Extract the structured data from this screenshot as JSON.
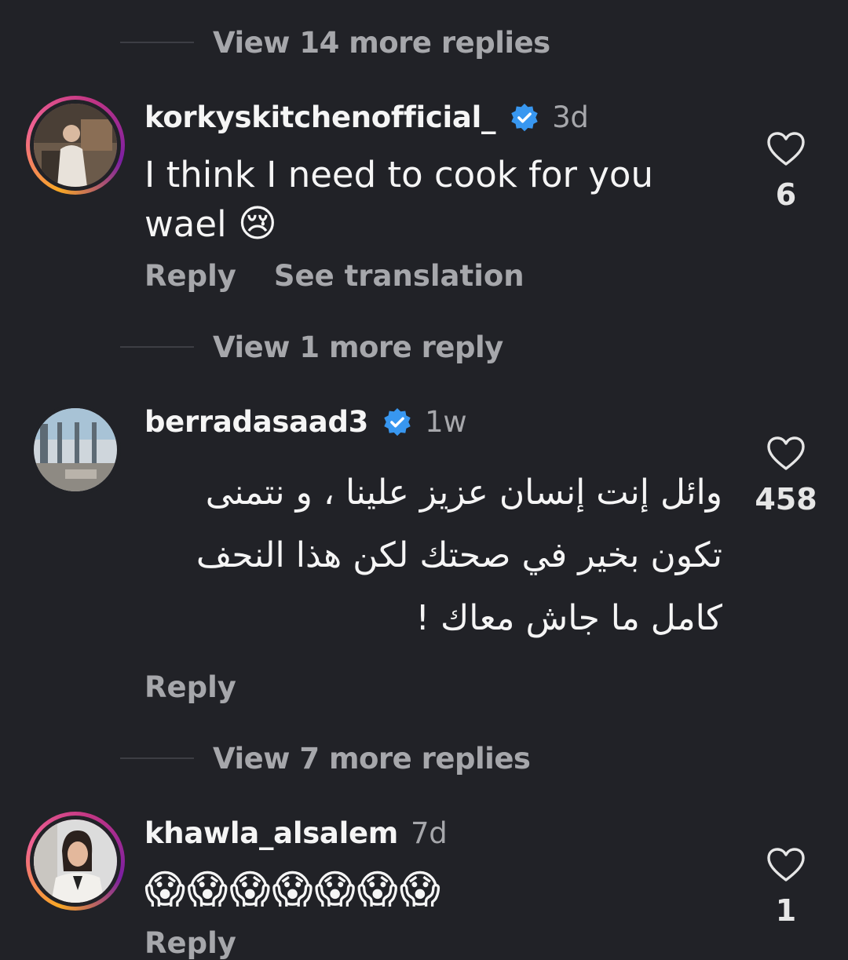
{
  "view_more_1": "View 14 more replies",
  "comments": [
    {
      "username": "korkyskitchenofficial_",
      "verified": true,
      "time": "3d",
      "text_line1": "I think I need to cook for you",
      "text_line2": "wael",
      "emoji": "😢",
      "reply": "Reply",
      "see_translation": "See translation",
      "likes": "6"
    },
    {
      "username": "berradasaad3",
      "verified": true,
      "time": "1w",
      "text_line1": "وائل إنت إنسان عزيز علينا ، و نتمنى",
      "text_line2": "تكون بخير في صحتك لكن هذا النحف",
      "text_line3": "كامل ما جاش معاك !",
      "reply": "Reply",
      "likes": "458"
    },
    {
      "username": "khawla_alsalem",
      "verified": false,
      "time": "7d",
      "emojis": "😱😱😱😱😱😱😱",
      "reply": "Reply",
      "likes": "1"
    }
  ],
  "view_more_2": "View 1 more reply",
  "view_more_3": "View 7 more replies",
  "colors": {
    "background": "#212227",
    "muted": "#a6a7ab",
    "verified": "#3897f0"
  }
}
